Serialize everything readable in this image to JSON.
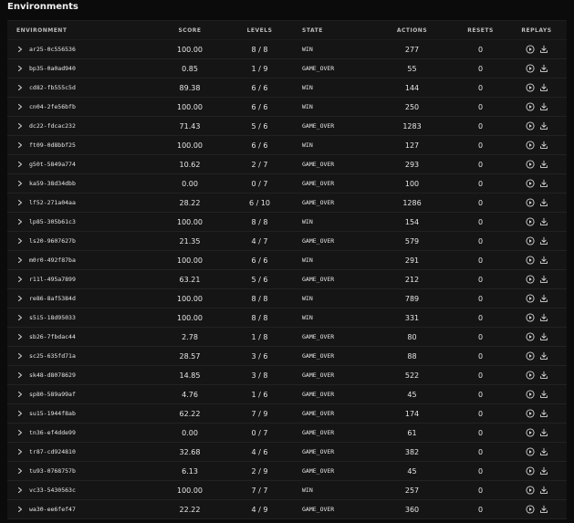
{
  "section": {
    "title": "Environments"
  },
  "columns": {
    "environment": "ENVIRONMENT",
    "score": "SCORE",
    "levels": "LEVELS",
    "state": "STATE",
    "actions": "ACTIONS",
    "resets": "RESETS",
    "replays": "REPLAYS"
  },
  "rows": [
    {
      "env": "ar25-0c556536",
      "score": "100.00",
      "levels": "8 / 8",
      "state": "WIN",
      "actions": "277",
      "resets": "0"
    },
    {
      "env": "bp35-0a0ad940",
      "score": "0.85",
      "levels": "1 / 9",
      "state": "GAME_OVER",
      "actions": "55",
      "resets": "0"
    },
    {
      "env": "cd82-fb555c5d",
      "score": "89.38",
      "levels": "6 / 6",
      "state": "WIN",
      "actions": "144",
      "resets": "0"
    },
    {
      "env": "cn04-2fe56bfb",
      "score": "100.00",
      "levels": "6 / 6",
      "state": "WIN",
      "actions": "250",
      "resets": "0"
    },
    {
      "env": "dc22-fdcac232",
      "score": "71.43",
      "levels": "5 / 6",
      "state": "GAME_OVER",
      "actions": "1283",
      "resets": "0"
    },
    {
      "env": "ft09-0d8bbf25",
      "score": "100.00",
      "levels": "6 / 6",
      "state": "WIN",
      "actions": "127",
      "resets": "0"
    },
    {
      "env": "g50t-5849a774",
      "score": "10.62",
      "levels": "2 / 7",
      "state": "GAME_OVER",
      "actions": "293",
      "resets": "0"
    },
    {
      "env": "ka59-38d34dbb",
      "score": "0.00",
      "levels": "0 / 7",
      "state": "GAME_OVER",
      "actions": "100",
      "resets": "0"
    },
    {
      "env": "lf52-271a04aa",
      "score": "28.22",
      "levels": "6 / 10",
      "state": "GAME_OVER",
      "actions": "1286",
      "resets": "0"
    },
    {
      "env": "lp85-305b61c3",
      "score": "100.00",
      "levels": "8 / 8",
      "state": "WIN",
      "actions": "154",
      "resets": "0"
    },
    {
      "env": "ls20-9607627b",
      "score": "21.35",
      "levels": "4 / 7",
      "state": "GAME_OVER",
      "actions": "579",
      "resets": "0"
    },
    {
      "env": "m0r0-492f87ba",
      "score": "100.00",
      "levels": "6 / 6",
      "state": "WIN",
      "actions": "291",
      "resets": "0"
    },
    {
      "env": "r11l-495a7899",
      "score": "63.21",
      "levels": "5 / 6",
      "state": "GAME_OVER",
      "actions": "212",
      "resets": "0"
    },
    {
      "env": "re86-8af5384d",
      "score": "100.00",
      "levels": "8 / 8",
      "state": "WIN",
      "actions": "789",
      "resets": "0"
    },
    {
      "env": "s5i5-18d95033",
      "score": "100.00",
      "levels": "8 / 8",
      "state": "WIN",
      "actions": "331",
      "resets": "0"
    },
    {
      "env": "sb26-7fbdac44",
      "score": "2.78",
      "levels": "1 / 8",
      "state": "GAME_OVER",
      "actions": "80",
      "resets": "0"
    },
    {
      "env": "sc25-635fd71a",
      "score": "28.57",
      "levels": "3 / 6",
      "state": "GAME_OVER",
      "actions": "88",
      "resets": "0"
    },
    {
      "env": "sk48-d8078629",
      "score": "14.85",
      "levels": "3 / 8",
      "state": "GAME_OVER",
      "actions": "522",
      "resets": "0"
    },
    {
      "env": "sp80-589a99af",
      "score": "4.76",
      "levels": "1 / 6",
      "state": "GAME_OVER",
      "actions": "45",
      "resets": "0"
    },
    {
      "env": "su15-1944f8ab",
      "score": "62.22",
      "levels": "7 / 9",
      "state": "GAME_OVER",
      "actions": "174",
      "resets": "0"
    },
    {
      "env": "tn36-ef4dde99",
      "score": "0.00",
      "levels": "0 / 7",
      "state": "GAME_OVER",
      "actions": "61",
      "resets": "0"
    },
    {
      "env": "tr87-cd924810",
      "score": "32.68",
      "levels": "4 / 6",
      "state": "GAME_OVER",
      "actions": "382",
      "resets": "0"
    },
    {
      "env": "tu93-0768757b",
      "score": "6.13",
      "levels": "2 / 9",
      "state": "GAME_OVER",
      "actions": "45",
      "resets": "0"
    },
    {
      "env": "vc33-5430563c",
      "score": "100.00",
      "levels": "7 / 7",
      "state": "WIN",
      "actions": "257",
      "resets": "0"
    },
    {
      "env": "wa30-ee6fef47",
      "score": "22.22",
      "levels": "4 / 9",
      "state": "GAME_OVER",
      "actions": "360",
      "resets": "0"
    }
  ],
  "icons": {
    "expand": "chevron-right-icon",
    "play": "play-circle-icon",
    "download": "download-icon"
  }
}
